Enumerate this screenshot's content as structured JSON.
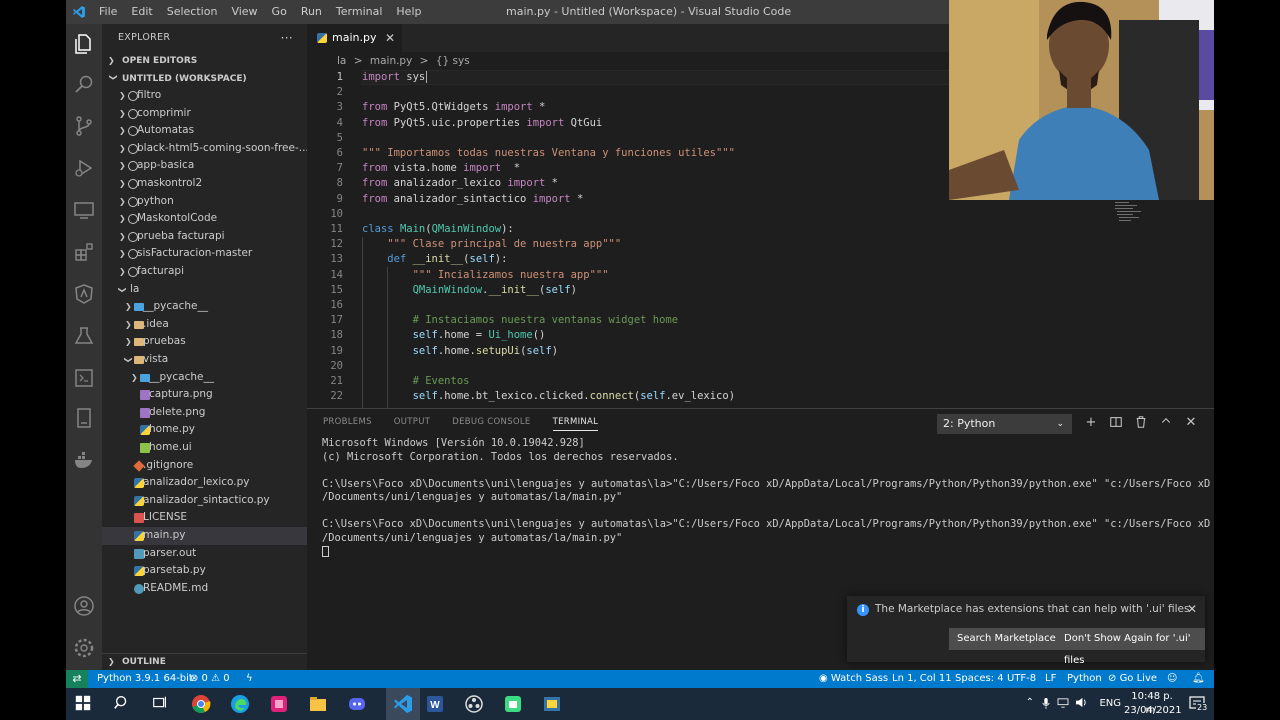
{
  "titlebar": {
    "menu": [
      "File",
      "Edit",
      "Selection",
      "View",
      "Go",
      "Run",
      "Terminal",
      "Help"
    ],
    "window_title": "main.py - Untitled (Workspace) - Visual Studio Code"
  },
  "sidebar": {
    "title": "EXPLORER",
    "more": "···",
    "open_editors": "OPEN EDITORS",
    "workspace": "UNTITLED (WORKSPACE)",
    "outline": "OUTLINE",
    "tree": [
      {
        "label": "filtro",
        "type": "root",
        "depth": 0
      },
      {
        "label": "comprimir",
        "type": "root",
        "depth": 0
      },
      {
        "label": "Automatas",
        "type": "root",
        "depth": 0
      },
      {
        "label": "black-html5-coming-soon-free-...",
        "type": "root",
        "depth": 0
      },
      {
        "label": "app-basica",
        "type": "root",
        "depth": 0
      },
      {
        "label": "maskontrol2",
        "type": "root",
        "depth": 0
      },
      {
        "label": "python",
        "type": "root",
        "depth": 0
      },
      {
        "label": "MaskontolCode",
        "type": "root",
        "depth": 0
      },
      {
        "label": "prueba facturapi",
        "type": "root",
        "depth": 0
      },
      {
        "label": "sisFacturacion-master",
        "type": "root",
        "depth": 0
      },
      {
        "label": "facturapi",
        "type": "root",
        "depth": 0
      },
      {
        "label": "la",
        "type": "root-open",
        "depth": 0
      },
      {
        "label": "__pycache__",
        "type": "folderb",
        "depth": 1
      },
      {
        "label": ".idea",
        "type": "folder",
        "depth": 1
      },
      {
        "label": "pruebas",
        "type": "folder",
        "depth": 1
      },
      {
        "label": "vista",
        "type": "folder-open",
        "depth": 1
      },
      {
        "label": "__pycache__",
        "type": "folderb",
        "depth": 2
      },
      {
        "label": "captura.png",
        "type": "img",
        "depth": 2
      },
      {
        "label": "delete.png",
        "type": "img",
        "depth": 2
      },
      {
        "label": "home.py",
        "type": "py",
        "depth": 2
      },
      {
        "label": "home.ui",
        "type": "ui",
        "depth": 2
      },
      {
        "label": ".gitignore",
        "type": "git",
        "depth": 1
      },
      {
        "label": "analizador_lexico.py",
        "type": "py",
        "depth": 1
      },
      {
        "label": "analizador_sintactico.py",
        "type": "py",
        "depth": 1
      },
      {
        "label": "LICENSE",
        "type": "lic",
        "depth": 1
      },
      {
        "label": "main.py",
        "type": "py",
        "depth": 1,
        "selected": true
      },
      {
        "label": "parser.out",
        "type": "out",
        "depth": 1
      },
      {
        "label": "parsetab.py",
        "type": "py",
        "depth": 1
      },
      {
        "label": "README.md",
        "type": "info",
        "depth": 1
      }
    ]
  },
  "editor": {
    "tab": "main.py",
    "tab_close": "✕",
    "breadcrumb": [
      "la",
      ">",
      "main.py",
      ">",
      "{} sys"
    ],
    "lines": [
      {
        "n": "1",
        "t": [
          [
            "import",
            "#c586c0"
          ],
          [
            " ",
            "#d4d4d4"
          ],
          [
            "sys",
            "#d4d4d4"
          ]
        ]
      },
      {
        "n": "2",
        "t": []
      },
      {
        "n": "3",
        "t": [
          [
            "from",
            "#c586c0"
          ],
          [
            " PyQt5.QtWidgets ",
            "#d4d4d4"
          ],
          [
            "import",
            "#c586c0"
          ],
          [
            " *",
            "#d4d4d4"
          ]
        ]
      },
      {
        "n": "4",
        "t": [
          [
            "from",
            "#c586c0"
          ],
          [
            " PyQt5.uic.properties ",
            "#d4d4d4"
          ],
          [
            "import",
            "#c586c0"
          ],
          [
            " QtGui",
            "#d4d4d4"
          ]
        ]
      },
      {
        "n": "5",
        "t": []
      },
      {
        "n": "6",
        "t": [
          [
            "\"\"\" Importamos todas nuestras Ventana y funciones utiles\"\"\"",
            "#ce9178"
          ]
        ]
      },
      {
        "n": "7",
        "t": [
          [
            "from",
            "#c586c0"
          ],
          [
            " vista.home ",
            "#d4d4d4"
          ],
          [
            "import",
            "#c586c0"
          ],
          [
            "  *",
            "#d4d4d4"
          ]
        ]
      },
      {
        "n": "8",
        "t": [
          [
            "from",
            "#c586c0"
          ],
          [
            " analizador_lexico ",
            "#d4d4d4"
          ],
          [
            "import",
            "#c586c0"
          ],
          [
            " *",
            "#d4d4d4"
          ]
        ]
      },
      {
        "n": "9",
        "t": [
          [
            "from",
            "#c586c0"
          ],
          [
            " analizador_sintactico ",
            "#d4d4d4"
          ],
          [
            "import",
            "#c586c0"
          ],
          [
            " *",
            "#d4d4d4"
          ]
        ]
      },
      {
        "n": "10",
        "t": []
      },
      {
        "n": "11",
        "t": [
          [
            "class",
            "#569cd6"
          ],
          [
            " ",
            "#d4d4d4"
          ],
          [
            "Main",
            "#4ec9b0"
          ],
          [
            "(",
            "#d4d4d4"
          ],
          [
            "QMainWindow",
            "#4ec9b0"
          ],
          [
            "):",
            "#d4d4d4"
          ]
        ]
      },
      {
        "n": "12",
        "t": [
          [
            "    \"\"\" Clase principal de nuestra app\"\"\"",
            "#ce9178"
          ]
        ]
      },
      {
        "n": "13",
        "t": [
          [
            "    ",
            "#d4d4d4"
          ],
          [
            "def",
            "#569cd6"
          ],
          [
            " ",
            "#d4d4d4"
          ],
          [
            "__init__",
            "#dcdcaa"
          ],
          [
            "(",
            "#d4d4d4"
          ],
          [
            "self",
            "#9cdcfe"
          ],
          [
            "):",
            "#d4d4d4"
          ]
        ]
      },
      {
        "n": "14",
        "t": [
          [
            "        \"\"\" Incializamos nuestra app\"\"\"",
            "#ce9178"
          ]
        ]
      },
      {
        "n": "15",
        "t": [
          [
            "        ",
            "#d4d4d4"
          ],
          [
            "QMainWindow",
            "#4ec9b0"
          ],
          [
            ".",
            "#d4d4d4"
          ],
          [
            "__init__",
            "#dcdcaa"
          ],
          [
            "(",
            "#d4d4d4"
          ],
          [
            "self",
            "#9cdcfe"
          ],
          [
            ")",
            "#d4d4d4"
          ]
        ]
      },
      {
        "n": "16",
        "t": []
      },
      {
        "n": "17",
        "t": [
          [
            "        # Instaciamos nuestra ventanas widget home",
            "#6a9955"
          ]
        ]
      },
      {
        "n": "18",
        "t": [
          [
            "        ",
            "#d4d4d4"
          ],
          [
            "self",
            "#9cdcfe"
          ],
          [
            ".home = ",
            "#d4d4d4"
          ],
          [
            "Ui_home",
            "#4ec9b0"
          ],
          [
            "()",
            "#d4d4d4"
          ]
        ]
      },
      {
        "n": "19",
        "t": [
          [
            "        ",
            "#d4d4d4"
          ],
          [
            "self",
            "#9cdcfe"
          ],
          [
            ".home.",
            "#d4d4d4"
          ],
          [
            "setupUi",
            "#dcdcaa"
          ],
          [
            "(",
            "#d4d4d4"
          ],
          [
            "self",
            "#9cdcfe"
          ],
          [
            ")",
            "#d4d4d4"
          ]
        ]
      },
      {
        "n": "20",
        "t": []
      },
      {
        "n": "21",
        "t": [
          [
            "        # Eventos",
            "#6a9955"
          ]
        ]
      },
      {
        "n": "22",
        "t": [
          [
            "        ",
            "#d4d4d4"
          ],
          [
            "self",
            "#9cdcfe"
          ],
          [
            ".home.bt_lexico.clicked.",
            "#d4d4d4"
          ],
          [
            "connect",
            "#dcdcaa"
          ],
          [
            "(",
            "#d4d4d4"
          ],
          [
            "self",
            "#9cdcfe"
          ],
          [
            ".ev_lexico)",
            "#d4d4d4"
          ]
        ]
      }
    ]
  },
  "panel": {
    "tabs": [
      "PROBLEMS",
      "OUTPUT",
      "DEBUG CONSOLE",
      "TERMINAL"
    ],
    "active_tab": "TERMINAL",
    "terminal_select": "2: Python",
    "terminal_lines": [
      "Microsoft Windows [Versión 10.0.19042.928]",
      "(c) Microsoft Corporation. Todos los derechos reservados.",
      "",
      "C:\\Users\\Foco xD\\Documents\\uni\\lenguajes y automatas\\la>\"C:/Users/Foco xD/AppData/Local/Programs/Python/Python39/python.exe\" \"c:/Users/Foco xD",
      "/Documents/uni/lenguajes y automatas/la/main.py\"",
      "",
      "C:\\Users\\Foco xD\\Documents\\uni\\lenguajes y automatas\\la>\"C:/Users/Foco xD/AppData/Local/Programs/Python/Python39/python.exe\" \"c:/Users/Foco xD",
      "/Documents/uni/lenguajes y automatas/la/main.py\""
    ]
  },
  "notification": {
    "text": "The Marketplace has extensions that can help with '.ui' files",
    "btn_search": "Search Marketplace",
    "btn_dismiss": "Don't Show Again for '.ui' files"
  },
  "statusbar": {
    "interpreter": "Python 3.9.1 64-bit",
    "problems": "⊗ 0 ⚠ 0",
    "watch_sass": "Watch Sass",
    "position": "Ln 1, Col 11",
    "spaces": "Spaces: 4",
    "encoding": "UTF-8",
    "eol": "LF",
    "language": "Python",
    "golive": "Go Live"
  },
  "taskbar": {
    "lang": "ENG",
    "time": "10:48 p. m.",
    "date": "23/04/2021",
    "notif_count": "23"
  }
}
